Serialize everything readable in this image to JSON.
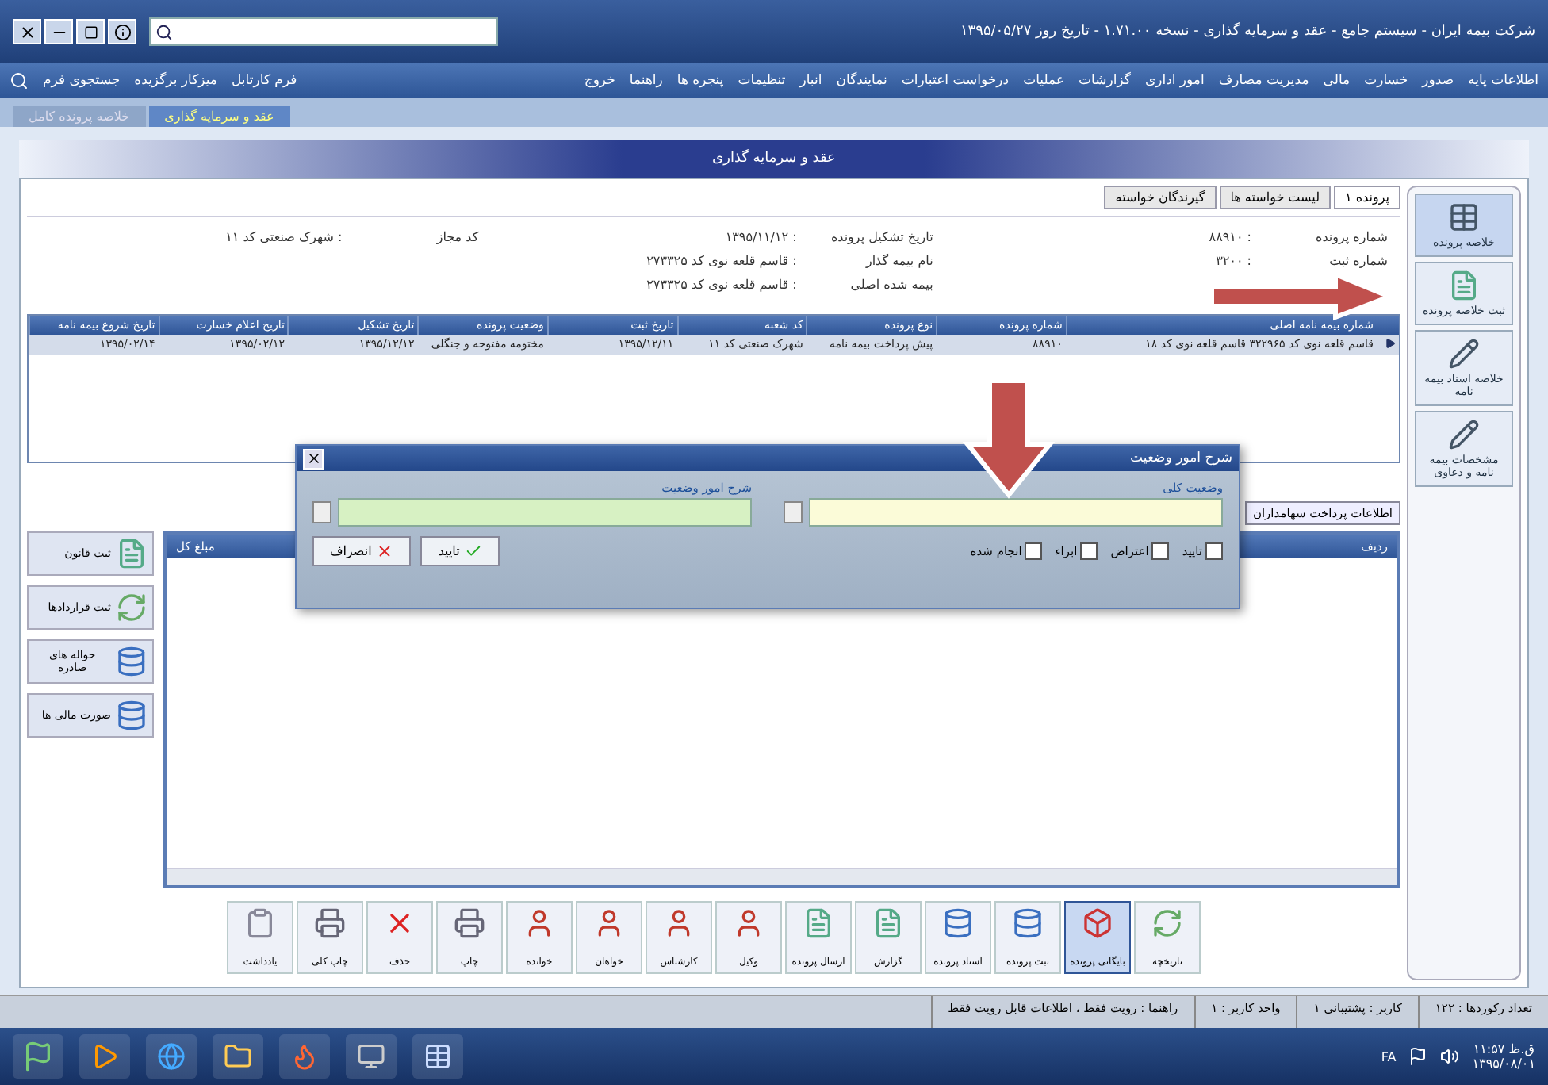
{
  "window": {
    "title": "شرکت بیمه ایران - سیستم جامع - عقد و سرمایه گذاری - نسخه ۱.۷۱.۰۰ - تاریخ روز ۱۳۹۵/۰۵/۲۷"
  },
  "menu": {
    "items": [
      "اطلاعات پایه",
      "صدور",
      "خسارت",
      "مالی",
      "مدیریت مصارف",
      "امور اداری",
      "گزارشات",
      "عملیات",
      "درخواست اعتبارات",
      "نمایندگان",
      "انبار",
      "تنظیمات",
      "پنجره ها",
      "راهنما",
      "خروج"
    ],
    "quick_links": [
      "فرم کارتابل",
      "میزکار برگزیده",
      "جستجوی فرم"
    ]
  },
  "tabs": [
    {
      "label": "عقد و سرمایه گذاری",
      "selected": true
    },
    {
      "label": "خلاصه پرونده کامل",
      "selected": false
    }
  ],
  "panel": {
    "title": "عقد و سرمایه گذاری"
  },
  "sidebar": {
    "items": [
      {
        "label": "خلاصه پرونده",
        "kind": "table",
        "selected": true
      },
      {
        "label": "ثبت خلاصه پرونده",
        "kind": "document",
        "selected": false
      },
      {
        "label": "خلاصه اسناد بیمه نامه",
        "kind": "edit",
        "selected": false
      },
      {
        "label": "مشخصات بیمه نامه و دعاوی",
        "kind": "edit",
        "selected": false
      }
    ]
  },
  "case_tabs": [
    {
      "label": "پرونده ۱",
      "selected": true
    },
    {
      "label": "لیست خواسته ها",
      "selected": false
    },
    {
      "label": "گیرندگان خواسته",
      "selected": false
    }
  ],
  "info": [
    [
      {
        "label": "شماره پرونده",
        "value": ": ۸۸۹۱۰"
      },
      {
        "label": "شماره ثبت",
        "value": ": ۳۲۰۰"
      }
    ],
    [
      {
        "label": "تاریخ تشکیل پرونده",
        "value": ": ۱۳۹۵/۱۱/۱۲"
      },
      {
        "label": "نام بیمه گذار",
        "value": ": قاسم قلعه نوی کد ۲۷۳۳۲۵"
      },
      {
        "label": "بیمه شده اصلی",
        "value": ": قاسم قلعه نوی کد ۲۷۳۳۲۵"
      }
    ],
    [
      {
        "label": "کد مجاز",
        "value": ": شهرک صنعتی کد ۱۱"
      }
    ]
  ],
  "table": {
    "columns": [
      "شماره بیمه نامه اصلی",
      "شماره پرونده",
      "نوع پرونده",
      "کد شعبه",
      "تاریخ ثبت",
      "وضعیت پرونده",
      "تاریخ تشکیل",
      "تاریخ اعلام خسارت",
      "تاریخ شروع بیمه نامه"
    ],
    "rows": [
      {
        "selected": true,
        "cells": [
          "قاسم قلعه نوی کد ۳۲۲۹۶۵ قاسم قلعه نوی کد ۱۸",
          "۸۸۹۱۰",
          "پیش پرداخت بیمه نامه",
          "شهرک صنعتی کد ۱۱",
          "۱۳۹۵/۱۲/۱۱",
          "مختومه مفتوحه و جنگلی",
          "۱۳۹۵/۱۲/۱۲",
          "۱۳۹۵/۰۲/۱۲",
          "۱۳۹۵/۰۲/۱۴"
        ]
      }
    ]
  },
  "dialog": {
    "title": "شرح امور وضعیت",
    "fields": [
      {
        "label": "وضعیت کلی",
        "kind": "select"
      },
      {
        "label": "شرح امور وضعیت",
        "kind": "text"
      }
    ],
    "checkboxes": [
      {
        "label": "تایید",
        "checked": false
      },
      {
        "label": "اعتراض",
        "checked": false
      },
      {
        "label": "ابراء",
        "checked": false
      },
      {
        "label": "انجام شده",
        "checked": false
      }
    ],
    "buttons": [
      {
        "label": "تایید",
        "kind": "ok"
      },
      {
        "label": "انصراف",
        "kind": "cancel"
      }
    ]
  },
  "payments_button": "اطلاعات پرداخت سهامداران",
  "grid": {
    "columns": [
      "ردیف",
      "مبلغ کل"
    ]
  },
  "side_buttons": [
    {
      "label": "ثبت قانون",
      "kind": "document"
    },
    {
      "label": "ثبت قراردادها",
      "kind": "refresh"
    },
    {
      "label": "حواله های صادره",
      "kind": "cylinder"
    },
    {
      "label": "صورت مالی ها",
      "kind": "cylinder"
    }
  ],
  "toolbar": [
    {
      "label": "تاریخچه",
      "kind": "refresh",
      "selected": false
    },
    {
      "label": "بایگانی پرونده",
      "kind": "cube",
      "selected": true
    },
    {
      "label": "ثبت پرونده",
      "kind": "cylinder",
      "selected": false
    },
    {
      "label": "اسناد پرونده",
      "kind": "cylinder",
      "selected": false
    },
    {
      "label": "گزارش",
      "kind": "document",
      "selected": false
    },
    {
      "label": "ارسال پرونده",
      "kind": "document",
      "selected": false
    },
    {
      "label": "وکیل",
      "kind": "person",
      "selected": false
    },
    {
      "label": "کارشناس",
      "kind": "person",
      "selected": false
    },
    {
      "label": "خواهان",
      "kind": "person",
      "selected": false
    },
    {
      "label": "خوانده",
      "kind": "person",
      "selected": false
    },
    {
      "label": "چاپ",
      "kind": "printer",
      "selected": false
    },
    {
      "label": "حذف",
      "kind": "delete",
      "selected": false
    },
    {
      "label": "چاپ کلی",
      "kind": "printer",
      "selected": false
    },
    {
      "label": "یادداشت",
      "kind": "clipboard",
      "selected": false
    }
  ],
  "status_bar": [
    "تعداد رکوردها : ۱۲۲",
    "کاربر : پشتیبانی ۱",
    "واحد کاربر : ۱",
    "راهنما : رویت فقط ، اطلاعات قابل رویت فقط"
  ],
  "taskbar": {
    "language": "FA",
    "time": "۱۱:۵۷ ق.ظ",
    "date": "۱۳۹۵/۰۸/۰۱"
  }
}
